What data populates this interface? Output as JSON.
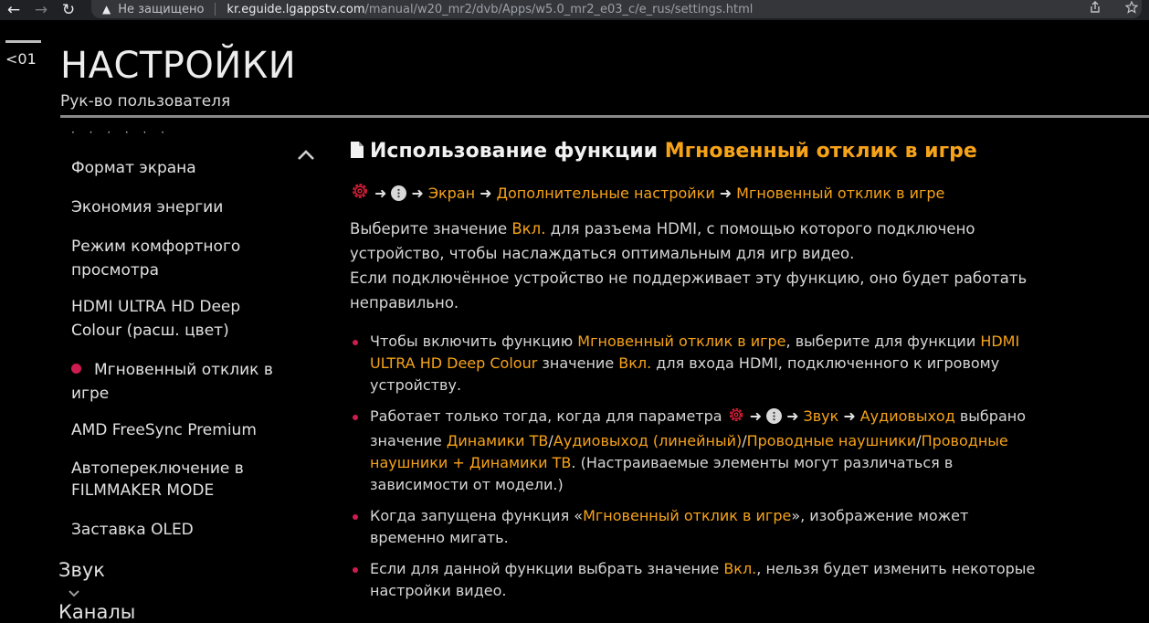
{
  "browser": {
    "insecure_label": "Не защищено",
    "url_host": "kr.eguide.lgappstv.com",
    "url_path": "/manual/w20_mr2/dvb/Apps/w5.0_mr2_e03_c/e_rus/settings.html"
  },
  "header": {
    "back_label": "<01",
    "title": "НАСТРОЙКИ",
    "subtitle": "Рук-во пользователя"
  },
  "sidebar": {
    "items": [
      {
        "label": "Формат экрана"
      },
      {
        "label": "Экономия энергии"
      },
      {
        "label": "Режим комфортного просмотра"
      },
      {
        "label": "HDMI ULTRA HD Deep Colour (расш. цвет)"
      },
      {
        "label": "Мгновенный отклик в игре",
        "active": true
      },
      {
        "label": "AMD FreeSync Premium"
      },
      {
        "label": "Автопереключение в FILMMAKER MODE"
      },
      {
        "label": "Заставка OLED"
      }
    ],
    "sections": [
      {
        "label": "Звук"
      },
      {
        "label": "Каналы"
      }
    ]
  },
  "content": {
    "heading_prefix": "Использование функции ",
    "heading_highlight": "Мгновенный отклик в игре",
    "path": [
      "Экран",
      "Дополнительные настройки",
      "Мгновенный отклик в игре"
    ],
    "para1_a": "Выберите значение ",
    "para1_hl": "Вкл.",
    "para1_b": " для разъема HDMI, с помощью которого подключено устройство, чтобы наслаждаться оптимальным для игр видео.",
    "para2": "Если подключённое устройство не поддерживает эту функцию, оно будет работать неправильно.",
    "b1": {
      "t1": "Чтобы включить функцию ",
      "h1": "Мгновенный отклик в игре",
      "t2": ", выберите для функции ",
      "h2": "HDMI ULTRA HD Deep Colour",
      "t3": " значение ",
      "h3": "Вкл.",
      "t4": " для входа HDMI, подключенного к игровому устройству."
    },
    "b2": {
      "t1": "Работает только тогда, когда для параметра ",
      "h1": "Звук",
      "h2": "Аудиовыход",
      "t2": " выбрано значение ",
      "h3": "Динамики ТВ",
      "s1": "/",
      "h4": "Аудиовыход (линейный)",
      "s2": "/",
      "h5": "Проводные наушники",
      "s3": "/",
      "h6": "Проводные наушники + Динамики ТВ",
      "t3": ". (Настраиваемые элементы могут различаться в зависимости от модели.)"
    },
    "b3": {
      "t1": "Когда запущена функция «",
      "h1": "Мгновенный отклик в игре",
      "t2": "», изображение может временно мигать."
    },
    "b4": {
      "t1": "Если для данной функции выбрать значение ",
      "h1": "Вкл.",
      "t2": ", нельзя будет изменить некоторые настройки видео."
    }
  },
  "colors": {
    "accent": "#f7a319",
    "bullet": "#cf1c4f",
    "gear": "#e0213b"
  },
  "icons": [
    "back-arrow-icon",
    "forward-arrow-icon",
    "reload-icon",
    "warning-icon",
    "share-icon",
    "collapse-chevron-up-icon",
    "document-icon",
    "settings-gear-icon",
    "more-options-icon",
    "chevron-down-icon"
  ]
}
